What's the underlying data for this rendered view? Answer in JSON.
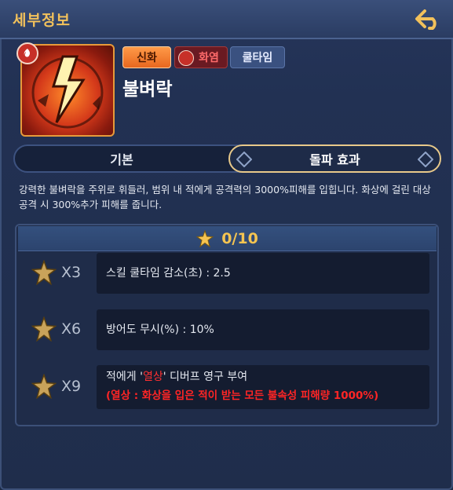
{
  "header": {
    "title": "세부정보",
    "back_icon": "back-arrow-icon"
  },
  "skill": {
    "name": "불벼락",
    "icon": "lightning-orb-icon",
    "element_icon": "fire-element-icon",
    "tags": {
      "rarity": "신화",
      "element": "화염",
      "type": "쿨타임"
    }
  },
  "tabs": [
    {
      "label": "기본",
      "active": false
    },
    {
      "label": "돌파 효과",
      "active": true
    }
  ],
  "description": "강력한 불벼락을 주위로 휘들러, 범위 내 적에게 공격력의 3000%피해를 입힙니다. 화상에 걸린 대상 공격 시 300%추가 피해를 줍니다.",
  "progress": {
    "icon": "star-icon",
    "text": "0/10"
  },
  "effects": [
    {
      "multiplier": "X3",
      "text": "스킬 쿨타임 감소(초) : 2.5"
    },
    {
      "multiplier": "X6",
      "text": "방어도 무시(%) : 10%"
    },
    {
      "multiplier": "X9",
      "text_before": "적에게 '",
      "text_highlight": "열상",
      "text_after": "' 디버프 영구 부여",
      "note": "(열상 : 화상을 입은 적이 받는 모든 불속성 피해량 1000%)"
    }
  ],
  "colors": {
    "accent": "#f2c15b",
    "highlight_red": "#ff3030",
    "panel": "#1f2d4b"
  }
}
